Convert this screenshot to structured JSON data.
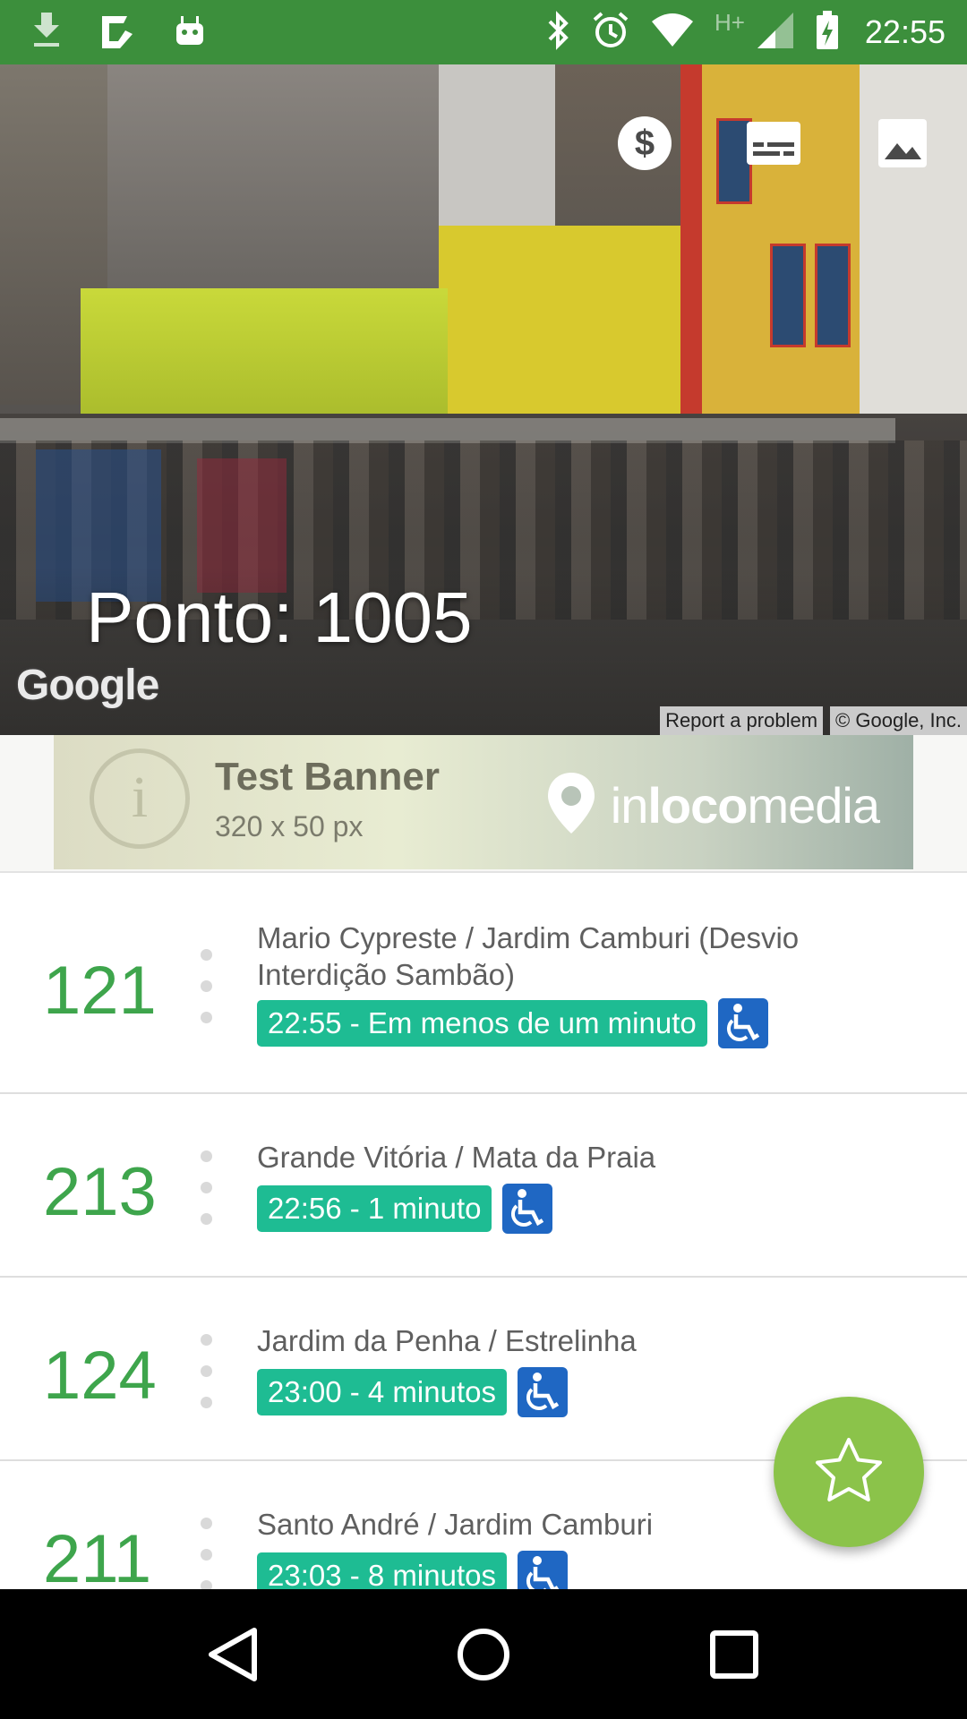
{
  "status_bar": {
    "time": "22:55",
    "network": "H+",
    "left_icons": [
      "download-icon",
      "play-store-icon",
      "android-icon"
    ],
    "right_icons": [
      "bluetooth-icon",
      "alarm-icon",
      "wifi-icon",
      "signal-icon",
      "battery-charging-icon"
    ]
  },
  "header": {
    "title": "Ponto: 1005",
    "google_logo": "Google",
    "report_label": "Report a problem",
    "copyright": "© Google, Inc.",
    "actions": [
      "dollar-icon",
      "subtitles-icon",
      "image-icon"
    ]
  },
  "banner": {
    "title": "Test Banner",
    "size": "320 x 50 px",
    "brand_part1": "in",
    "brand_part2": "loco",
    "brand_part3": "media"
  },
  "arrivals": [
    {
      "route": "121",
      "destination": "Mario Cypreste / Jardim Camburi (Desvio Interdição Sambão)",
      "eta": "22:55 - Em menos de um minuto",
      "accessible": true
    },
    {
      "route": "213",
      "destination": "Grande Vitória / Mata da Praia",
      "eta": "22:56 - 1 minuto",
      "accessible": true
    },
    {
      "route": "124",
      "destination": "Jardim da Penha / Estrelinha",
      "eta": "23:00 - 4 minutos",
      "accessible": true
    },
    {
      "route": "211",
      "destination": "Santo André / Jardim Camburi",
      "eta": "23:03 - 8 minutos",
      "accessible": true
    }
  ],
  "colors": {
    "status_bar": "#3c8f3c",
    "route_number": "#3ea54c",
    "eta_badge": "#1ebc93",
    "accessibility_badge": "#1f67c3",
    "fab": "#8bc34a"
  }
}
